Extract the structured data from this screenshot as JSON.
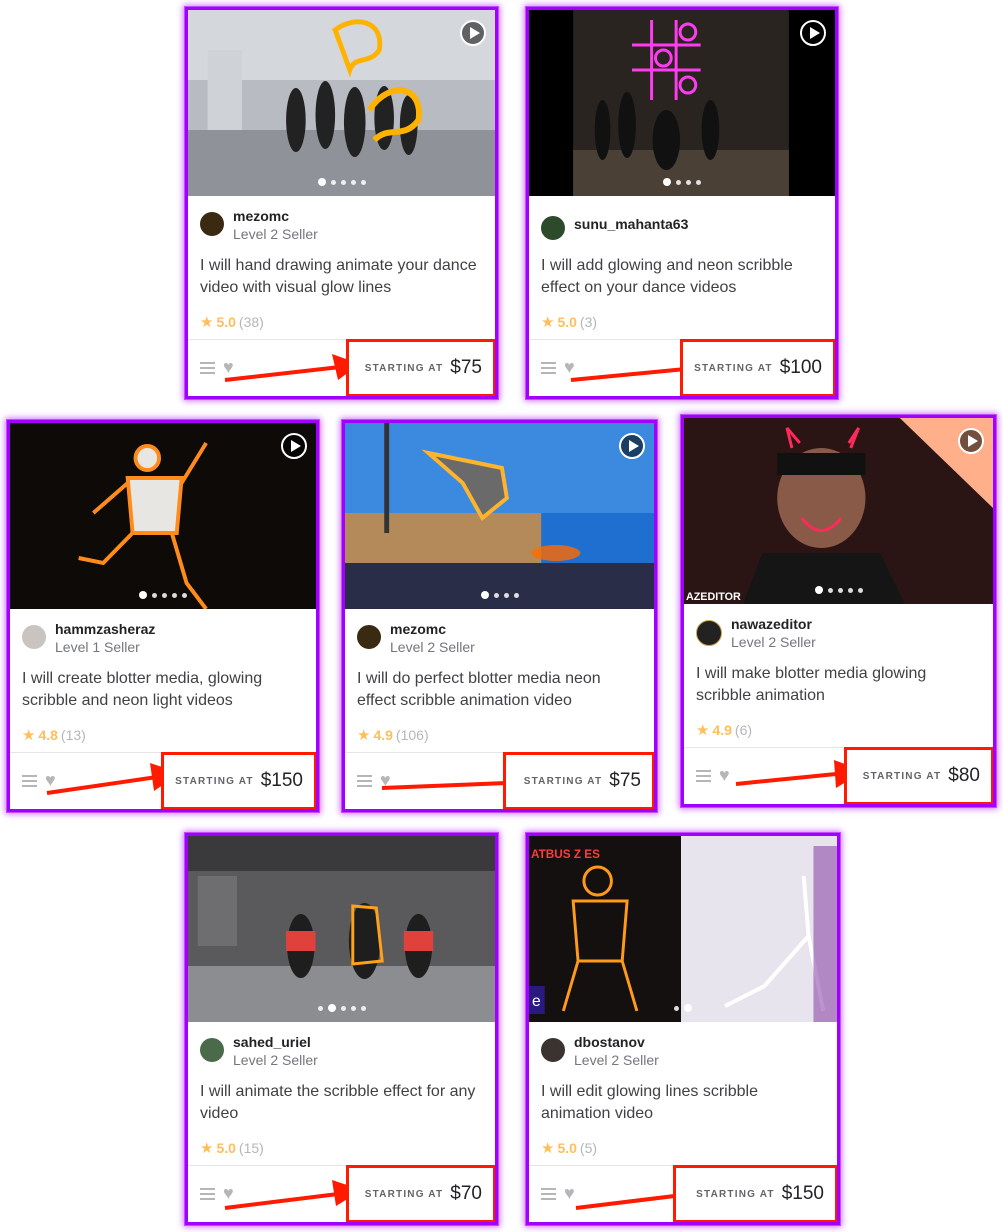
{
  "gigs": [
    {
      "seller": "mezomc",
      "level": "Level 2 Seller",
      "title": "I will hand drawing animate your dance video with visual glow lines",
      "rating": "5.0",
      "reviews": "(38)",
      "starting_at": "STARTING AT",
      "price": "$75"
    },
    {
      "seller": "sunu_mahanta63",
      "level": "",
      "title": "I will add glowing and neon scribble effect on your dance videos",
      "rating": "5.0",
      "reviews": "(3)",
      "starting_at": "STARTING AT",
      "price": "$100"
    },
    {
      "seller": "hammzasheraz",
      "level": "Level 1 Seller",
      "title": "I will create blotter media, glowing scribble and neon light videos",
      "rating": "4.8",
      "reviews": "(13)",
      "starting_at": "STARTING AT",
      "price": "$150"
    },
    {
      "seller": "mezomc",
      "level": "Level 2 Seller",
      "title": "I will do perfect blotter media neon effect scribble animation video",
      "rating": "4.9",
      "reviews": "(106)",
      "starting_at": "STARTING AT",
      "price": "$75"
    },
    {
      "seller": "nawazeditor",
      "level": "Level 2 Seller",
      "title": "I will make blotter media glowing scribble animation",
      "rating": "4.9",
      "reviews": "(6)",
      "starting_at": "STARTING AT",
      "price": "$80"
    },
    {
      "seller": "sahed_uriel",
      "level": "Level 2 Seller",
      "title": "I will animate the scribble effect for any video",
      "rating": "5.0",
      "reviews": "(15)",
      "starting_at": "STARTING AT",
      "price": "$70"
    },
    {
      "seller": "dbostanov",
      "level": "Level 2 Seller",
      "title": "I will edit glowing lines scribble animation video",
      "rating": "5.0",
      "reviews": "(5)",
      "starting_at": "STARTING AT",
      "price": "$150"
    }
  ],
  "thumb_text": {
    "card4_thumb": "AZEDITOR",
    "card7_thumb": "ATBUS Z ES",
    "card7_badge": "e"
  },
  "colors": {
    "card_border": "#a100ff",
    "highlight": "#ff1a00",
    "star": "#ffbe5b"
  }
}
